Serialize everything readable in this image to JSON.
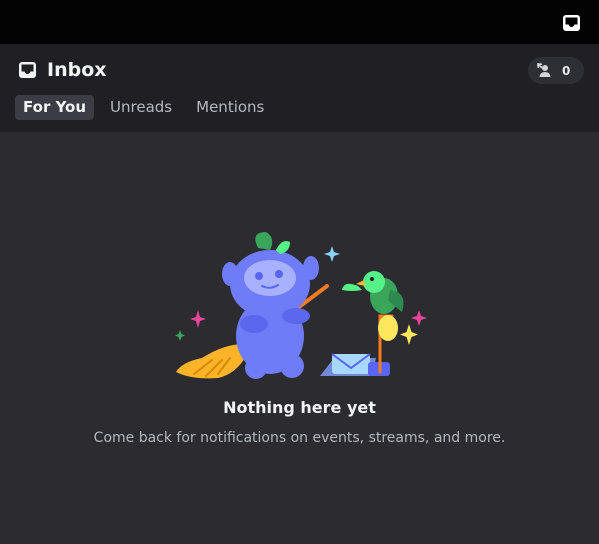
{
  "header": {
    "title": "Inbox",
    "friends_count": "0"
  },
  "tabs": [
    {
      "label": "For You",
      "active": true
    },
    {
      "label": "Unreads",
      "active": false
    },
    {
      "label": "Mentions",
      "active": false
    }
  ],
  "empty_state": {
    "title": "Nothing here yet",
    "subtitle": "Come back for notifications on events, streams, and more."
  },
  "icons": {
    "topbar": "inbox-icon",
    "header": "inbox-icon",
    "friends": "friend-request-icon"
  },
  "colors": {
    "accent": "#5865f2",
    "background": "#2b2b30",
    "header_background": "#202024"
  }
}
